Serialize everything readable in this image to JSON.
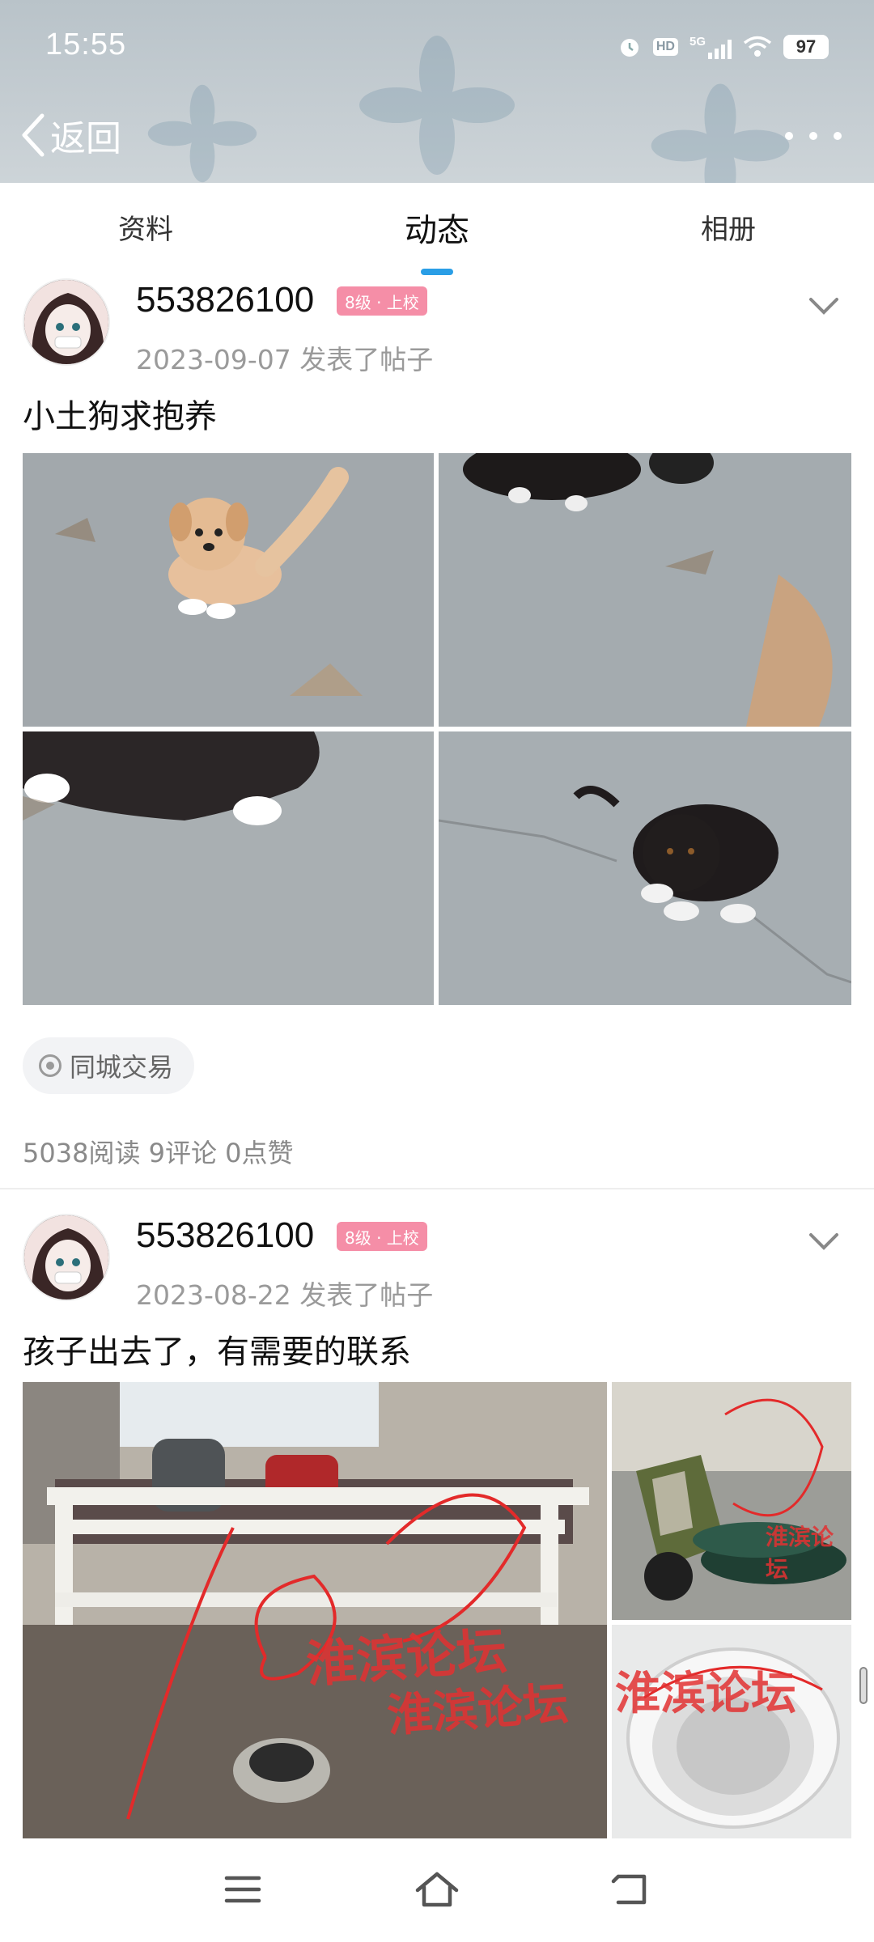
{
  "status_bar": {
    "time": "15:55",
    "icons": [
      "alarm-icon",
      "hd-icon",
      "5g-signal-icon",
      "wifi-icon"
    ],
    "hd_label": "HD",
    "network_label": "5G",
    "battery": "97"
  },
  "nav": {
    "back_label": "返回",
    "more_icon": "more-dots-icon"
  },
  "tabs": [
    {
      "label": "资料",
      "active": false
    },
    {
      "label": "动态",
      "active": true
    },
    {
      "label": "相册",
      "active": false
    }
  ],
  "posts": [
    {
      "username": "553826100",
      "level": "8级 · 上校",
      "date_action": "2023-09-07  发表了帖子",
      "title": "小土狗求抱养",
      "tag": "同城交易",
      "stats": "5038阅读 9评论 0点赞"
    },
    {
      "username": "553826100",
      "level": "8级 · 上校",
      "date_action": "2023-08-22  发表了帖子",
      "title": "孩子出去了，有需要的联系",
      "watermark": "淮滨论坛"
    }
  ],
  "bottom_nav": {
    "icons": [
      "menu-icon",
      "home-icon",
      "back-icon"
    ]
  },
  "colors": {
    "accent": "#2a9ee6",
    "badge": "#f58ea7",
    "watermark": "#e23232"
  }
}
